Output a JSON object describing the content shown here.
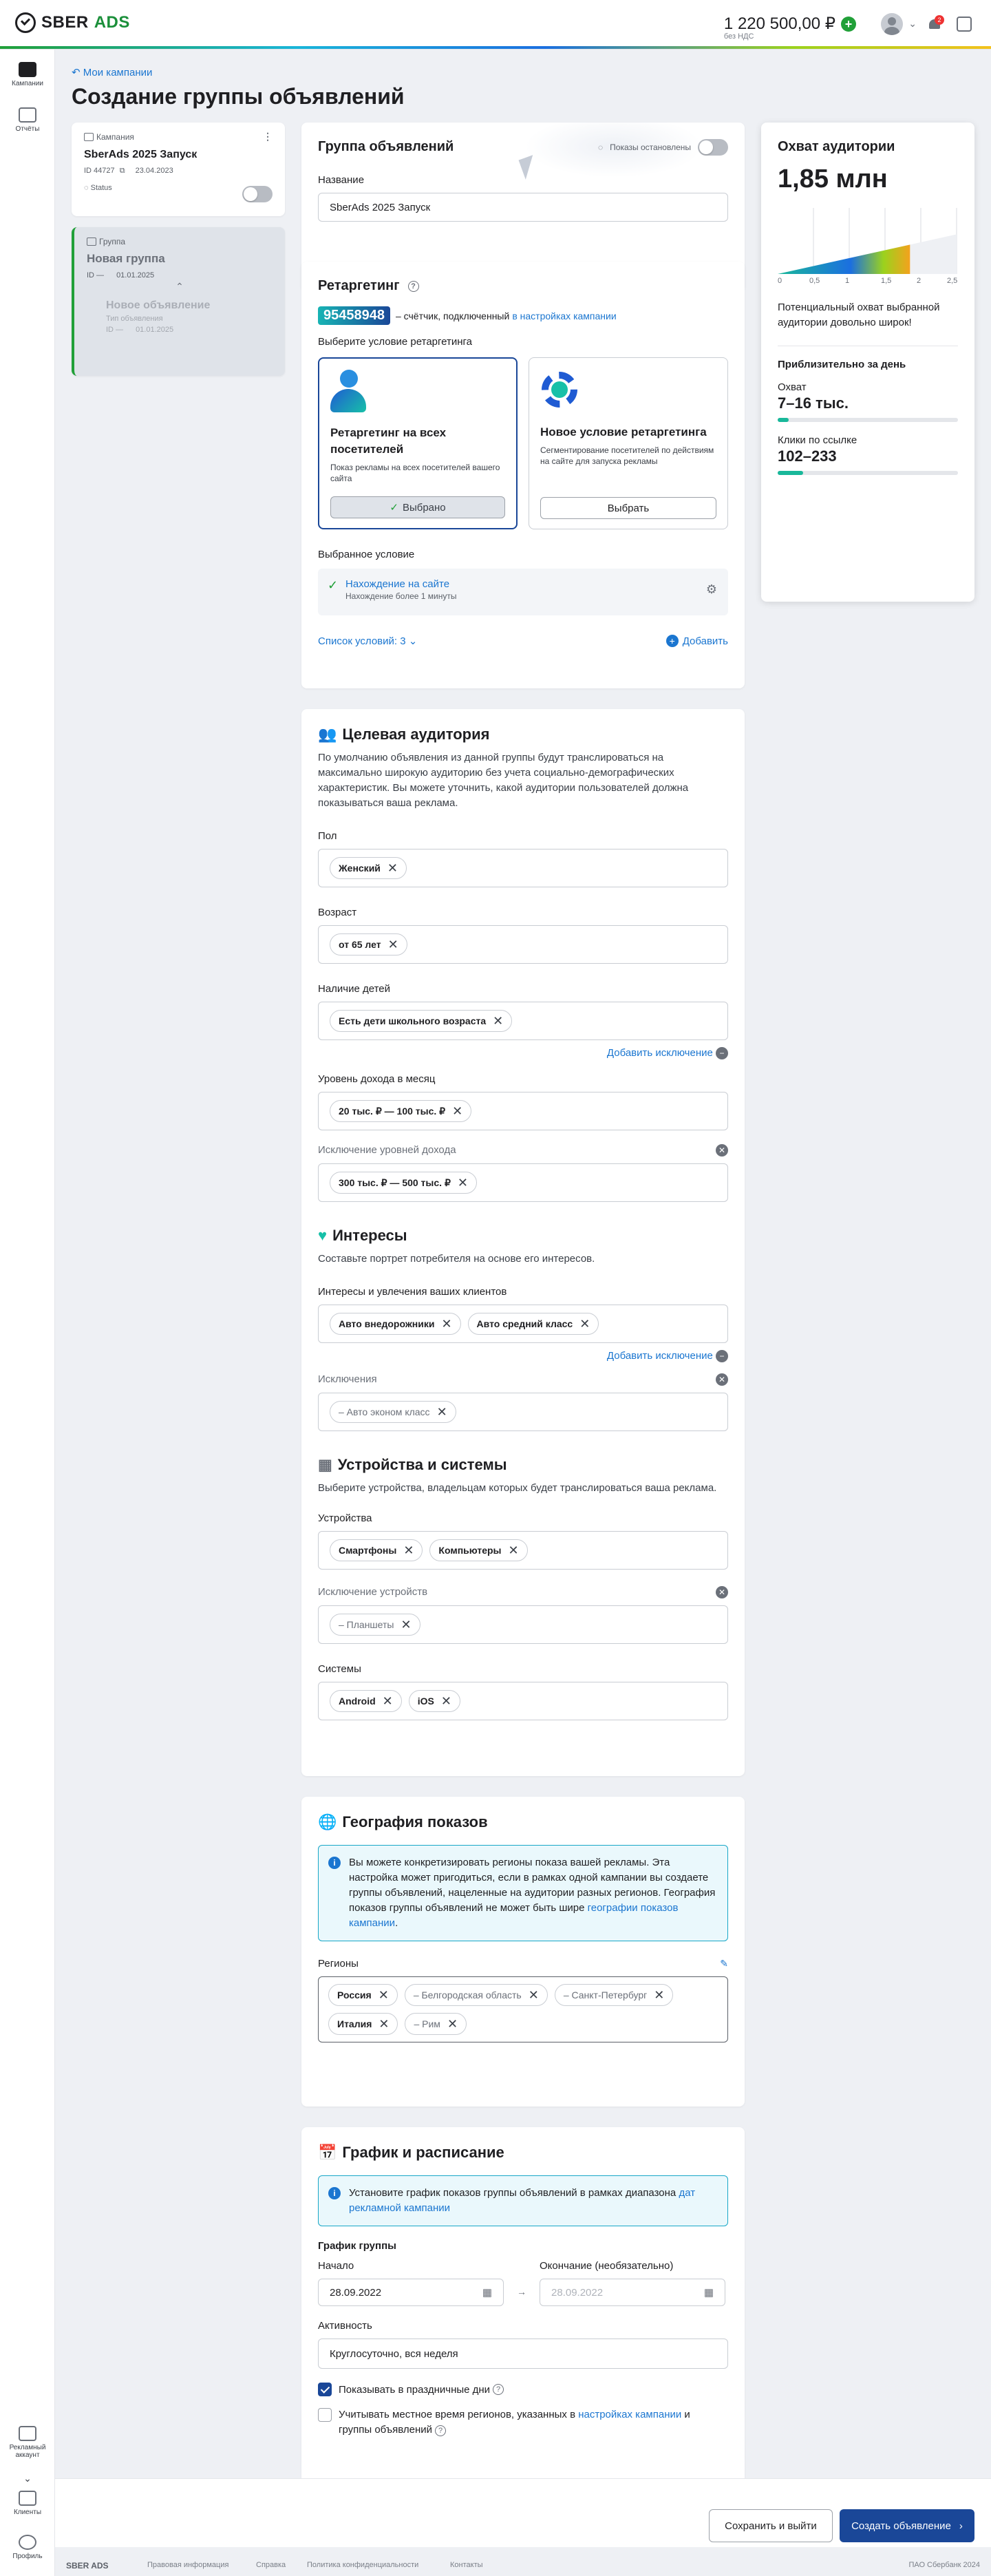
{
  "header": {
    "logo_sber": "SBER",
    "logo_ads": "ADS",
    "balance": "1 220 500,00 ₽",
    "vat_note": "без НДС",
    "notifications_count": "2"
  },
  "sidebar": {
    "items": [
      {
        "label": "Кампании"
      },
      {
        "label": "Отчёты"
      },
      {
        "label": "Рекламный аккаунт"
      },
      {
        "label": "Клиенты"
      },
      {
        "label": "Профиль"
      }
    ]
  },
  "page": {
    "breadcrumb": "Мои кампании",
    "title": "Создание группы объявлений"
  },
  "campaign_card": {
    "type_label": "Кампания",
    "name": "SberAds 2025 Запуск",
    "id": "ID 44727",
    "date": "23.04.2023",
    "status_label": "Status"
  },
  "group_card": {
    "type_label": "Группа",
    "name": "Новая группа",
    "id": "ID —",
    "date": "01.01.2025",
    "ad_name": "Новое объявление",
    "ad_sub": "Тип объявления",
    "ad_id": "ID —",
    "ad_date": "01.01.2025"
  },
  "ad_group": {
    "title": "Группа объявлений",
    "shows_label": "Показы остановлены",
    "name_label": "Название",
    "name_value": "SberAds 2025 Запуск"
  },
  "retargeting": {
    "title": "Ретаргетинг",
    "counter": "95458948",
    "counter_text": "– счётчик, подключенный",
    "counter_link": "в настройках кампании",
    "choose_label": "Выберите условие ретаргетинга",
    "option1_title": "Ретаргетинг на  всех посетителей",
    "option1_desc": "Показ рекламы на всех посетителей вашего сайта",
    "option1_btn": "Выбрано",
    "option2_title": "Новое условие ретаргетинга",
    "option2_desc": "Сегментирование посетителей по действиям на сайте для запуска рекламы",
    "option2_btn": "Выбрать",
    "selected_label": "Выбранное условие",
    "selected_name": "Нахождение на сайте",
    "selected_sub": "Нахождение более 1 минуты",
    "list_label": "Список условий: 3",
    "add_label": "Добавить"
  },
  "audience": {
    "title": "Целевая аудитория",
    "desc": "По умолчанию объявления из данной группы будут транслироваться на максимально широкую аудиторию без учета социально-демографических характеристик. Вы можете уточнить, какой аудитории пользователей должна показываться ваша реклама.",
    "gender_label": "Пол",
    "gender_chip": "Женский",
    "age_label": "Возраст",
    "age_chip": "от 65 лет",
    "kids_label": "Наличие детей",
    "kids_chip": "Есть дети школьного возраста",
    "add_exclusion": "Добавить исключение",
    "income_label": "Уровень дохода в месяц",
    "income_chip": "20 тыс. ₽ — 100 тыс. ₽",
    "income_excl_label": "Исключение уровней дохода",
    "income_excl_chip": "300 тыс. ₽ — 500 тыс. ₽"
  },
  "interests": {
    "title": "Интересы",
    "desc": "Составьте портрет потребителя на основе его интересов.",
    "label": "Интересы и увлечения ваших клиентов",
    "chips": [
      "Авто внедорожники",
      "Авто средний класс"
    ],
    "add_exclusion": "Добавить исключение",
    "excl_label": "Исключения",
    "excl_chip": "– Авто эконом класс"
  },
  "devices": {
    "title": "Устройства и системы",
    "desc": "Выберите устройства, владельцам которых будет транслироваться ваша реклама.",
    "devices_label": "Устройства",
    "devices_chips": [
      "Смартфоны",
      "Компьютеры"
    ],
    "excl_label": "Исключение устройств",
    "excl_chip": "– Планшеты",
    "systems_label": "Системы",
    "systems_chips": [
      "Android",
      "iOS"
    ]
  },
  "geo": {
    "title": "География показов",
    "info": "Вы можете конкретизировать регионы показа вашей рекламы. Эта настройка может пригодиться, если в рамках одной кампании вы создаете группы объявлений, нацеленные на аудитории разных регионов. География показов группы объявлений не может быть шире",
    "info_link": "географии показов кампании",
    "regions_label": "Регионы",
    "chips": [
      {
        "text": "Россия",
        "excl": false
      },
      {
        "text": "– Белгородская область",
        "excl": true
      },
      {
        "text": "– Санкт-Петербург",
        "excl": true
      },
      {
        "text": "Италия",
        "excl": false
      },
      {
        "text": "– Рим",
        "excl": true
      }
    ]
  },
  "schedule": {
    "title": "График и расписание",
    "info": "Установите график показов группы объявлений в рамках диапазона",
    "info_link": "дат рекламной кампании",
    "group_label": "График группы",
    "start_label": "Начало",
    "start_value": "28.09.2022",
    "end_label": "Окончание (необязательно)",
    "end_placeholder": "28.09.2022",
    "activity_label": "Активность",
    "activity_value": "Круглосуточно, вся неделя",
    "holidays_label": "Показывать в праздничные дни",
    "localtime_label": "Учитывать местное время регионов, указанных в",
    "localtime_link": "настройках кампании",
    "localtime_tail": "и группы объявлений"
  },
  "reach": {
    "title": "Охват аудитории",
    "value": "1,85 млн",
    "scale": [
      "0",
      "0,5",
      "1",
      "1,5",
      "2",
      "2,5"
    ],
    "reach_fraction": 0.74,
    "desc": "Потенциальный охват выбранной аудитории довольно широк!",
    "daily_title": "Приблизительно за день",
    "coverage_label": "Охват",
    "coverage_value": "7–16 тыс.",
    "coverage_fraction": 0.06,
    "clicks_label": "Клики по ссылке",
    "clicks_value": "102–233",
    "clicks_fraction": 0.14
  },
  "actions": {
    "save_exit": "Сохранить и выйти",
    "create": "Создать объявление"
  },
  "footer": {
    "logo": "SBER ADS",
    "links": [
      "Правовая информация",
      "Справка",
      "Политика конфиденциальности",
      "Контакты"
    ],
    "copyright": "ПАО Сбербанк 2024"
  },
  "colors": {
    "accent": "#1a4798",
    "brand": "#21a038",
    "link": "#1b76d0"
  }
}
